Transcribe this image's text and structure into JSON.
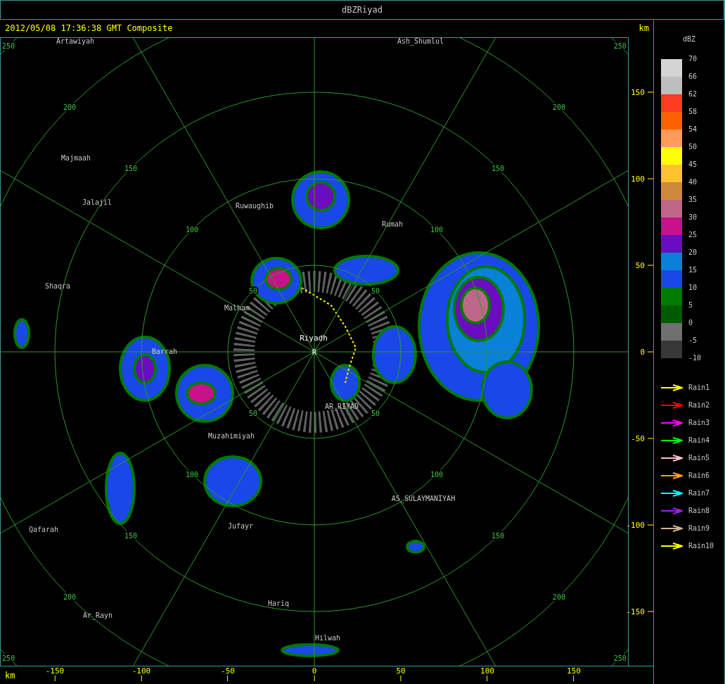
{
  "window": {
    "title": "dBZRiyad"
  },
  "header": {
    "timestamp": "2012/05/08 17:36:38 GMT Composite"
  },
  "map": {
    "range_rings": [
      {
        "labels": [
          "50",
          "50",
          "50",
          "50"
        ]
      },
      {
        "labels": [
          "100",
          "100",
          "100",
          "100"
        ]
      },
      {
        "labels": [
          "150",
          "150",
          "150",
          "150"
        ]
      },
      {
        "labels": [
          "200",
          "200",
          "200",
          "200"
        ]
      },
      {
        "labels": [
          "250",
          "250",
          "250",
          "250"
        ]
      }
    ],
    "places": [
      {
        "name": "Artawiyah",
        "kind": "town"
      },
      {
        "name": "Ash_Shumlul",
        "kind": "town"
      },
      {
        "name": "Majmaah",
        "kind": "town"
      },
      {
        "name": "Jalajil",
        "kind": "town"
      },
      {
        "name": "Ruwaughib",
        "kind": "town"
      },
      {
        "name": "Rumah",
        "kind": "town"
      },
      {
        "name": "Shaqra",
        "kind": "town"
      },
      {
        "name": "Malham",
        "kind": "town"
      },
      {
        "name": "Riyadh",
        "kind": "radar"
      },
      {
        "name": "Barrah",
        "kind": "town"
      },
      {
        "name": "AR_RIYAD",
        "kind": "town"
      },
      {
        "name": "Muzahimiyah",
        "kind": "town"
      },
      {
        "name": "AS_SULAYMANIYAH",
        "kind": "town"
      },
      {
        "name": "Jufayr",
        "kind": "town"
      },
      {
        "name": "Qafarah",
        "kind": "town"
      },
      {
        "name": "Hariq",
        "kind": "town"
      },
      {
        "name": "Ar_Rayn",
        "kind": "town"
      },
      {
        "name": "Hilwah",
        "kind": "town"
      }
    ],
    "radar_marker": "R"
  },
  "y_axis": {
    "unit": "km",
    "ticks": [
      "150",
      "100",
      "50",
      "0",
      "-50",
      "-100",
      "-150"
    ]
  },
  "x_axis": {
    "unit": "km",
    "ticks": [
      "-150",
      "-100",
      "-50",
      "0",
      "50",
      "100",
      "150"
    ]
  },
  "legend": {
    "title": "dBZ",
    "scale": [
      "70",
      "66",
      "62",
      "58",
      "54",
      "50",
      "45",
      "40",
      "35",
      "30",
      "25",
      "20",
      "15",
      "10",
      "5",
      "0",
      "-5",
      "-10"
    ],
    "bands": [
      {
        "color": "#d4d4d4"
      },
      {
        "color": "#bebebe"
      },
      {
        "color": "#fd3a22"
      },
      {
        "color": "#ff6000"
      },
      {
        "color": "#ff9a5a"
      },
      {
        "color": "#ffff00"
      },
      {
        "color": "#fbc42e"
      },
      {
        "color": "#cd8a3e"
      },
      {
        "color": "#bd6888"
      },
      {
        "color": "#c8118a"
      },
      {
        "color": "#6a0dc0"
      },
      {
        "color": "#0b80d8"
      },
      {
        "color": "#1a48e8"
      },
      {
        "color": "#007a00"
      },
      {
        "color": "#005a00"
      },
      {
        "color": "#707070"
      },
      {
        "color": "#383838"
      }
    ],
    "tracks": [
      {
        "label": "Rain1",
        "color": "#ffff00"
      },
      {
        "label": "Rain2",
        "color": "#ff0000"
      },
      {
        "label": "Rain3",
        "color": "#ff00ff"
      },
      {
        "label": "Rain4",
        "color": "#00ff00"
      },
      {
        "label": "Rain5",
        "color": "#ffc0cb"
      },
      {
        "label": "Rain6",
        "color": "#ffa500"
      },
      {
        "label": "Rain7",
        "color": "#00ffff"
      },
      {
        "label": "Rain8",
        "color": "#a020f0"
      },
      {
        "label": "Rain9",
        "color": "#d2b48c"
      },
      {
        "label": "Rain10",
        "color": "#ffff00"
      }
    ]
  }
}
